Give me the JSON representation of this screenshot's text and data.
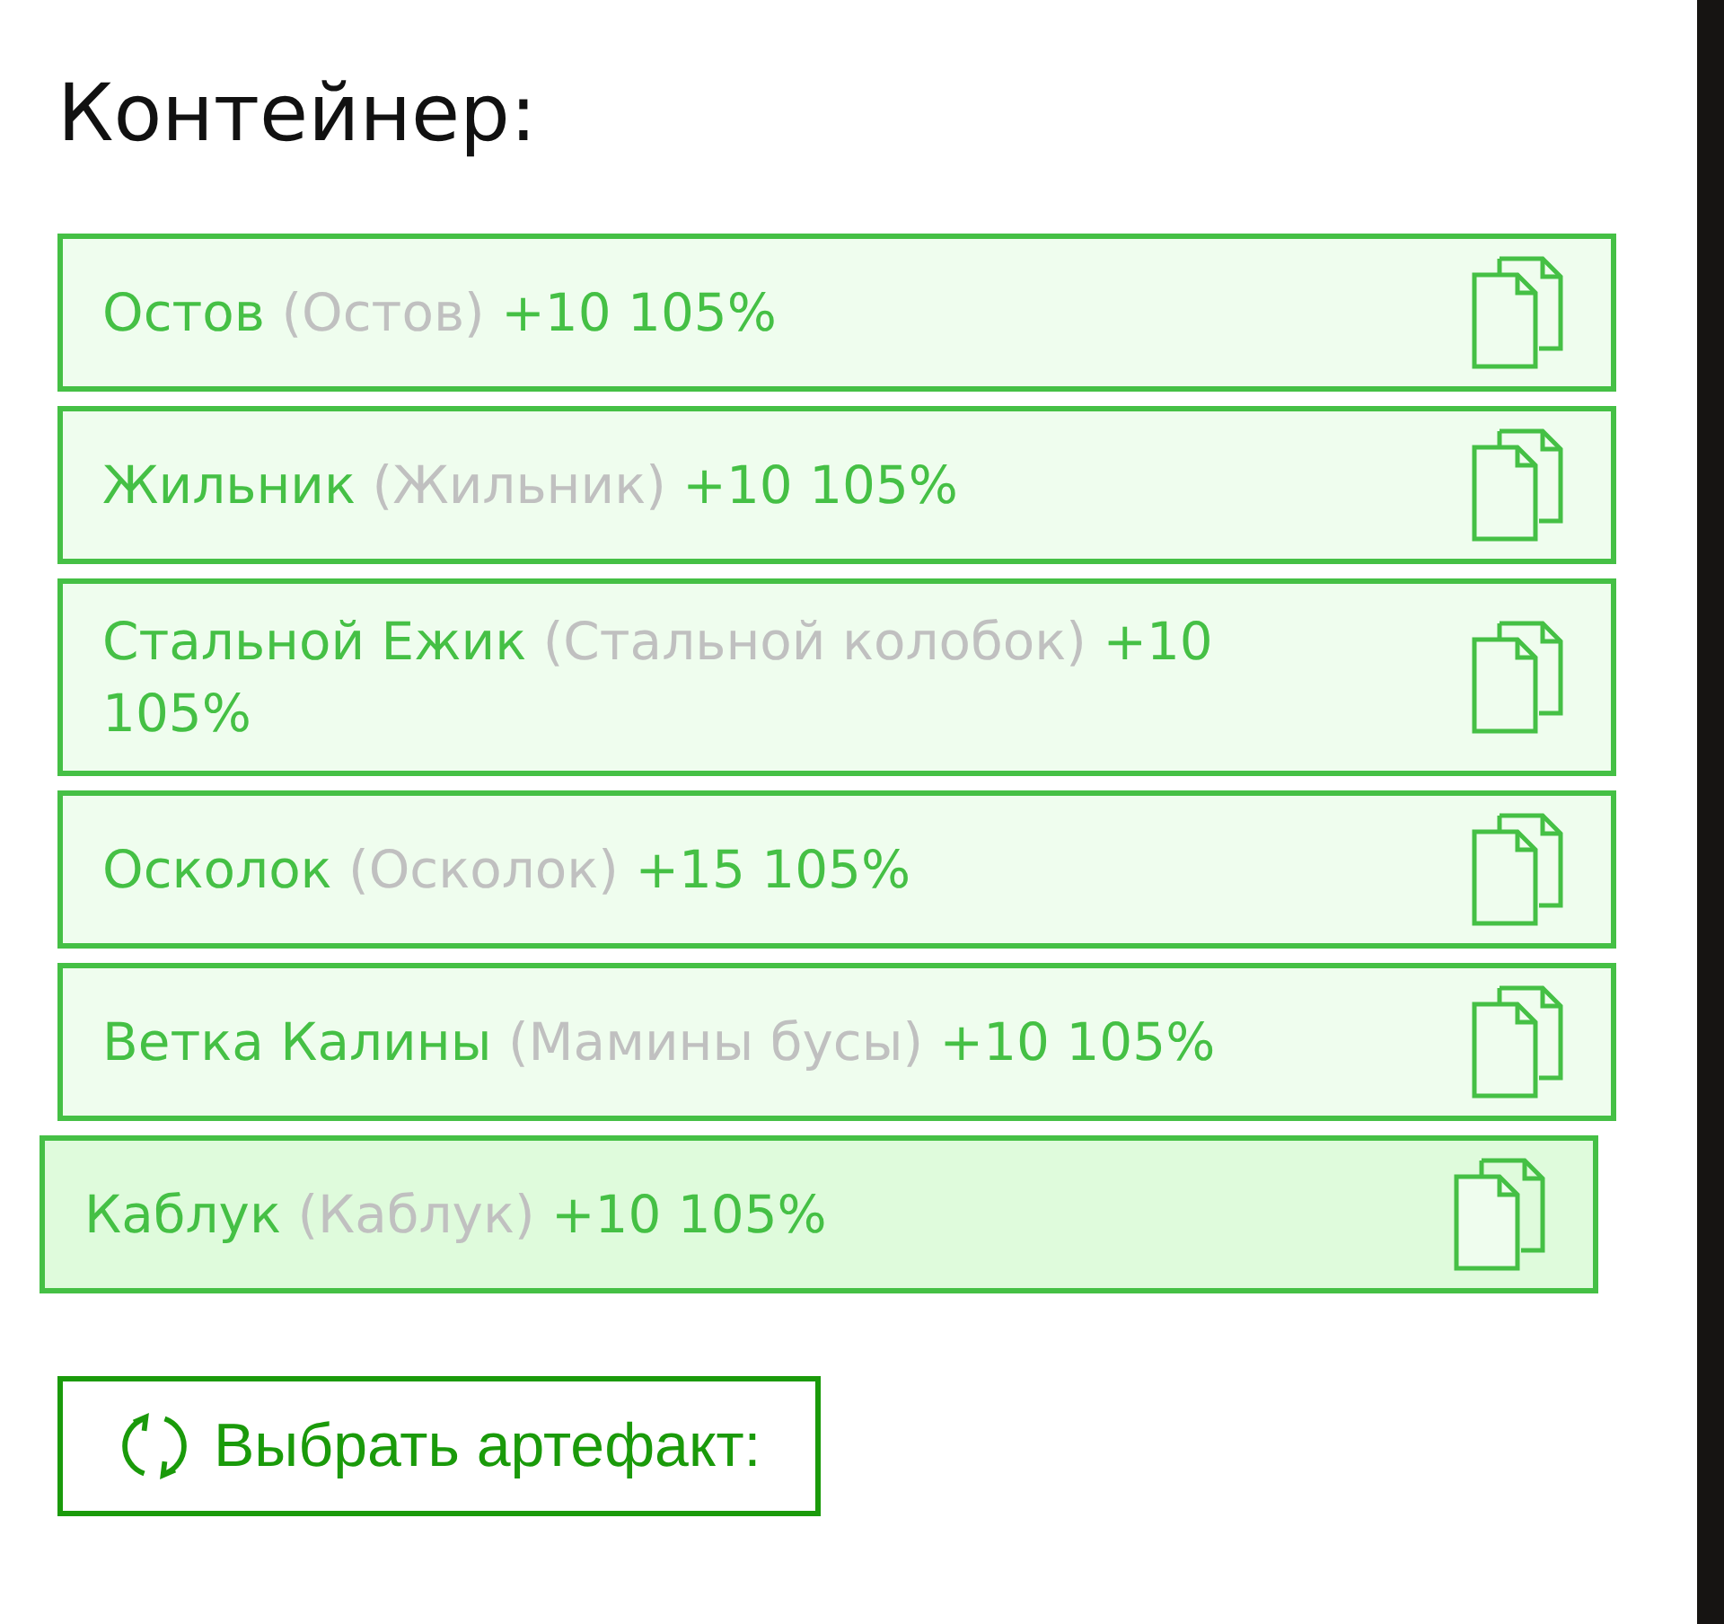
{
  "title": "Контейнер:",
  "items": [
    {
      "name": "Остов",
      "alias": "(Остов)",
      "stats": "+10 105%",
      "dragging": false
    },
    {
      "name": "Жильник",
      "alias": "(Жильник)",
      "stats": "+10 105%",
      "dragging": false
    },
    {
      "name": "Стальной Ежик",
      "alias": "(Стальной колобок)",
      "stats": "+10 105%",
      "dragging": false
    },
    {
      "name": "Осколок",
      "alias": "(Осколок)",
      "stats": "+15 105%",
      "dragging": false
    },
    {
      "name": "Ветка Калины",
      "alias": "(Мамины бусы)",
      "stats": "+10 105%",
      "dragging": false
    },
    {
      "name": "Каблук",
      "alias": "(Каблук)",
      "stats": "+10 105%",
      "dragging": true
    }
  ],
  "button": {
    "label": "Выбрать артефакт:"
  }
}
